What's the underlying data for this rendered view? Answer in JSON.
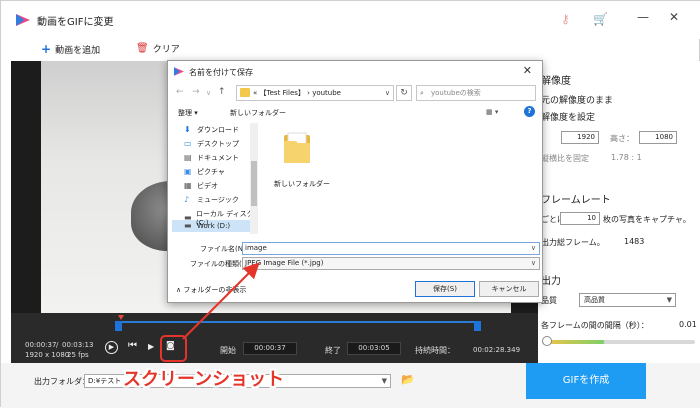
{
  "app": {
    "title": "動画をGIFに変更",
    "toolbar": {
      "add_video": "動画を追加",
      "clear": "クリア"
    }
  },
  "timeline": {
    "current_time": "00:00:37",
    "separator": "/",
    "total_time": "00:03:13",
    "resolution": "1920 x 1080",
    "fps": "25 fps",
    "start_label": "開始",
    "start_value": "00:00:37",
    "end_label": "終了",
    "end_value": "00:03:05",
    "duration_label": "持続時間：",
    "duration_value": "00:02:28.349"
  },
  "output": {
    "folder_label": "出力フォルダ：",
    "folder_value": "D:¥テスト",
    "convert_button": "GIFを作成"
  },
  "settings": {
    "resolution_title": "解像度",
    "keep_original": "元の解像度のまま",
    "set_resolution": "解像度を設定",
    "width_value": "1920",
    "height_label": "高さ：",
    "height_value": "1080",
    "lock_ratio": "縦横比を固定",
    "ratio_value": "1.78 : 1",
    "framerate_title": "フレームレート",
    "every_prefix": "ごとに",
    "every_value": "10",
    "every_suffix": "枚の写真をキャプチャ。",
    "total_frames_label": "出力総フレーム。",
    "total_frames_value": "1483",
    "output_title": "出力",
    "quality_label": "品質",
    "quality_value": "高品質",
    "interval_label": "各フレームの間の間隔（秒）：",
    "interval_value": "0.01",
    "interval_level": 0.4
  },
  "dialog": {
    "title": "名前を付けて保存",
    "path_prefix": "«",
    "path_part1": "【Test Files】",
    "path_sep": "›",
    "path_part2": "youtube",
    "search_placeholder": "youtubeの検索",
    "organize": "整理 ▾",
    "new_folder": "新しいフォルダー",
    "nav_items": [
      {
        "label": "ダウンロード",
        "icon": "download-icon"
      },
      {
        "label": "デスクトップ",
        "icon": "desktop-icon"
      },
      {
        "label": "ドキュメント",
        "icon": "document-icon"
      },
      {
        "label": "ピクチャ",
        "icon": "pictures-icon"
      },
      {
        "label": "ビデオ",
        "icon": "video-icon"
      },
      {
        "label": "ミュージック",
        "icon": "music-icon"
      },
      {
        "label": "ローカル ディスク (C:)",
        "icon": "drive-icon"
      },
      {
        "label": "Work (D:)",
        "icon": "drive-icon"
      }
    ],
    "folder_item": "新しいフォルダー",
    "filename_label": "ファイル名(N):",
    "filename_value": "image",
    "filetype_label": "ファイルの種類(T):",
    "filetype_value": "JPEG Image File (*.jpg)",
    "hide_folders": "フォルダーの非表示",
    "save_button": "保存(S)",
    "cancel_button": "キャンセル"
  },
  "annotation": {
    "caption": "スクリーンショット",
    "color": "#e5352a"
  }
}
